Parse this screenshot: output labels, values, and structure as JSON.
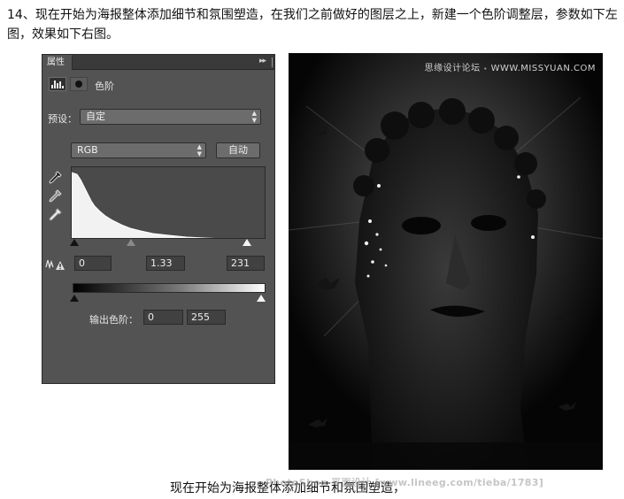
{
  "intro": {
    "text": "14、现在开始为海报整体添加细节和氛围塑造，在我们之前做好的图层之上，新建一个色阶调整层，参数如下左图，效果如下右图。"
  },
  "panel": {
    "tab_label": "属性",
    "menu_glyph": "▸▸",
    "title": "色阶",
    "preset_label": "预设：",
    "preset_value": "自定",
    "channel_value": "RGB",
    "auto_label": "自动",
    "input_levels": {
      "black": "0",
      "gamma": "1.33",
      "white": "231",
      "black_level": 0,
      "gamma_fraction": 0.34,
      "white_level": 231
    },
    "output_label": "输出色阶：",
    "output_levels": {
      "black": "0",
      "white": "255",
      "black_level": 0,
      "white_level": 255
    },
    "icons": [
      "levels-adjustment-icon",
      "layer-mask-icon",
      "eyedropper-black-icon",
      "eyedropper-gray-icon",
      "eyedropper-white-icon",
      "clipping-warning-icon"
    ]
  },
  "artwork": {
    "watermark_left": "思缘设计论坛",
    "watermark_sep": "•",
    "watermark_right": "WWW.MISSYUAN.COM"
  },
  "caption": {
    "text": "现在开始为海报整体添加细节和氛围塑造，",
    "watermark": "PhotoShop 平面设计 [www.lineeg.com/tieba/1783]"
  },
  "colors": {
    "panel_bg": "#535353",
    "panel_dark": "#3a3a3a",
    "field_bg": "#414141",
    "page_bg": "#ffffff"
  }
}
